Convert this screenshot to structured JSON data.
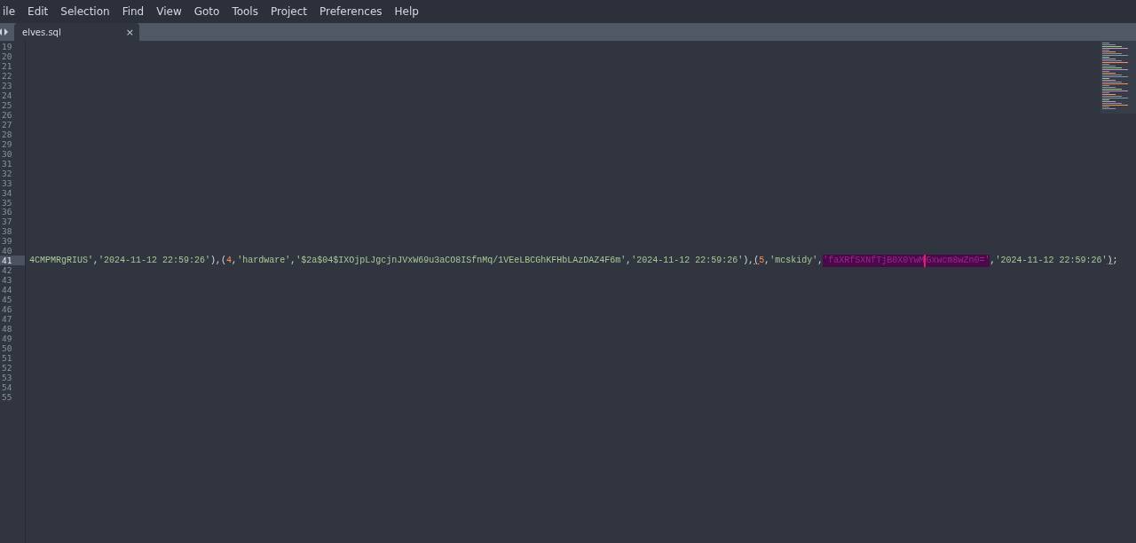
{
  "menu": [
    "ile",
    "Edit",
    "Selection",
    "Find",
    "View",
    "Goto",
    "Tools",
    "Project",
    "Preferences",
    "Help"
  ],
  "tabs": [
    {
      "label": "elves.sql",
      "close": "×",
      "selected": true
    }
  ],
  "editor": {
    "lines": [
      {
        "number": "19",
        "current": false
      },
      {
        "number": "20",
        "current": false
      },
      {
        "number": "21",
        "current": false
      },
      {
        "number": "22",
        "current": false
      },
      {
        "number": "23",
        "current": false
      },
      {
        "number": "24",
        "current": false
      },
      {
        "number": "25",
        "current": false
      },
      {
        "number": "26",
        "current": false
      },
      {
        "number": "27",
        "current": false
      },
      {
        "number": "28",
        "current": false
      },
      {
        "number": "29",
        "current": false
      },
      {
        "number": "30",
        "current": false
      },
      {
        "number": "31",
        "current": false
      },
      {
        "number": "32",
        "current": false
      },
      {
        "number": "33",
        "current": false
      },
      {
        "number": "34",
        "current": false
      },
      {
        "number": "35",
        "current": false
      },
      {
        "number": "36",
        "current": false
      },
      {
        "number": "37",
        "current": false
      },
      {
        "number": "38",
        "current": false
      },
      {
        "number": "39",
        "current": false
      },
      {
        "number": "40",
        "current": false
      },
      {
        "number": "41",
        "current": true,
        "tokens": [
          {
            "kind": "string",
            "text": "4CMPMRgRIUS'"
          },
          {
            "kind": "punct",
            "text": ","
          },
          {
            "kind": "string",
            "text": "'2024-11-12 22:59:26'"
          },
          {
            "kind": "punct",
            "text": "),"
          },
          {
            "kind": "punct",
            "text": "(",
            "bracket_match": false
          },
          {
            "kind": "number",
            "text": "4"
          },
          {
            "kind": "punct",
            "text": ","
          },
          {
            "kind": "string",
            "text": "'hardware'"
          },
          {
            "kind": "punct",
            "text": ","
          },
          {
            "kind": "string",
            "text": "'$2a$04$IXOjpLJgcjnJVxW69u3aCO8ISfnMq/1VEeLBCGhKFHbLAzDAZ4F6m'"
          },
          {
            "kind": "punct",
            "text": ","
          },
          {
            "kind": "string",
            "text": "'2024-11-12 22:59:26'"
          },
          {
            "kind": "punct",
            "text": "),"
          },
          {
            "kind": "punct",
            "text": "(",
            "bracket_match": true
          },
          {
            "kind": "number",
            "text": "5"
          },
          {
            "kind": "punct",
            "text": ","
          },
          {
            "kind": "string",
            "text": "'mcskidy'"
          },
          {
            "kind": "punct",
            "text": ","
          },
          {
            "kind": "selected",
            "text": "'faXRfSXNfTjB0X0YwM"
          },
          {
            "kind": "caret"
          },
          {
            "kind": "selected",
            "text": "Gxwcm8wZn0='"
          },
          {
            "kind": "punct",
            "text": ","
          },
          {
            "kind": "string",
            "text": "'2024-11-12 22:59:26'"
          },
          {
            "kind": "punct",
            "text": ")",
            "bracket_match": true
          },
          {
            "kind": "punct",
            "text": ";"
          }
        ]
      },
      {
        "number": "42",
        "current": false
      },
      {
        "number": "43",
        "current": false
      },
      {
        "number": "44",
        "current": false
      },
      {
        "number": "45",
        "current": false
      },
      {
        "number": "46",
        "current": false
      },
      {
        "number": "47",
        "current": false
      },
      {
        "number": "48",
        "current": false
      },
      {
        "number": "49",
        "current": false
      },
      {
        "number": "50",
        "current": false
      },
      {
        "number": "51",
        "current": false
      },
      {
        "number": "52",
        "current": false
      },
      {
        "number": "53",
        "current": false
      },
      {
        "number": "54",
        "current": false
      },
      {
        "number": "55",
        "current": false
      }
    ]
  }
}
